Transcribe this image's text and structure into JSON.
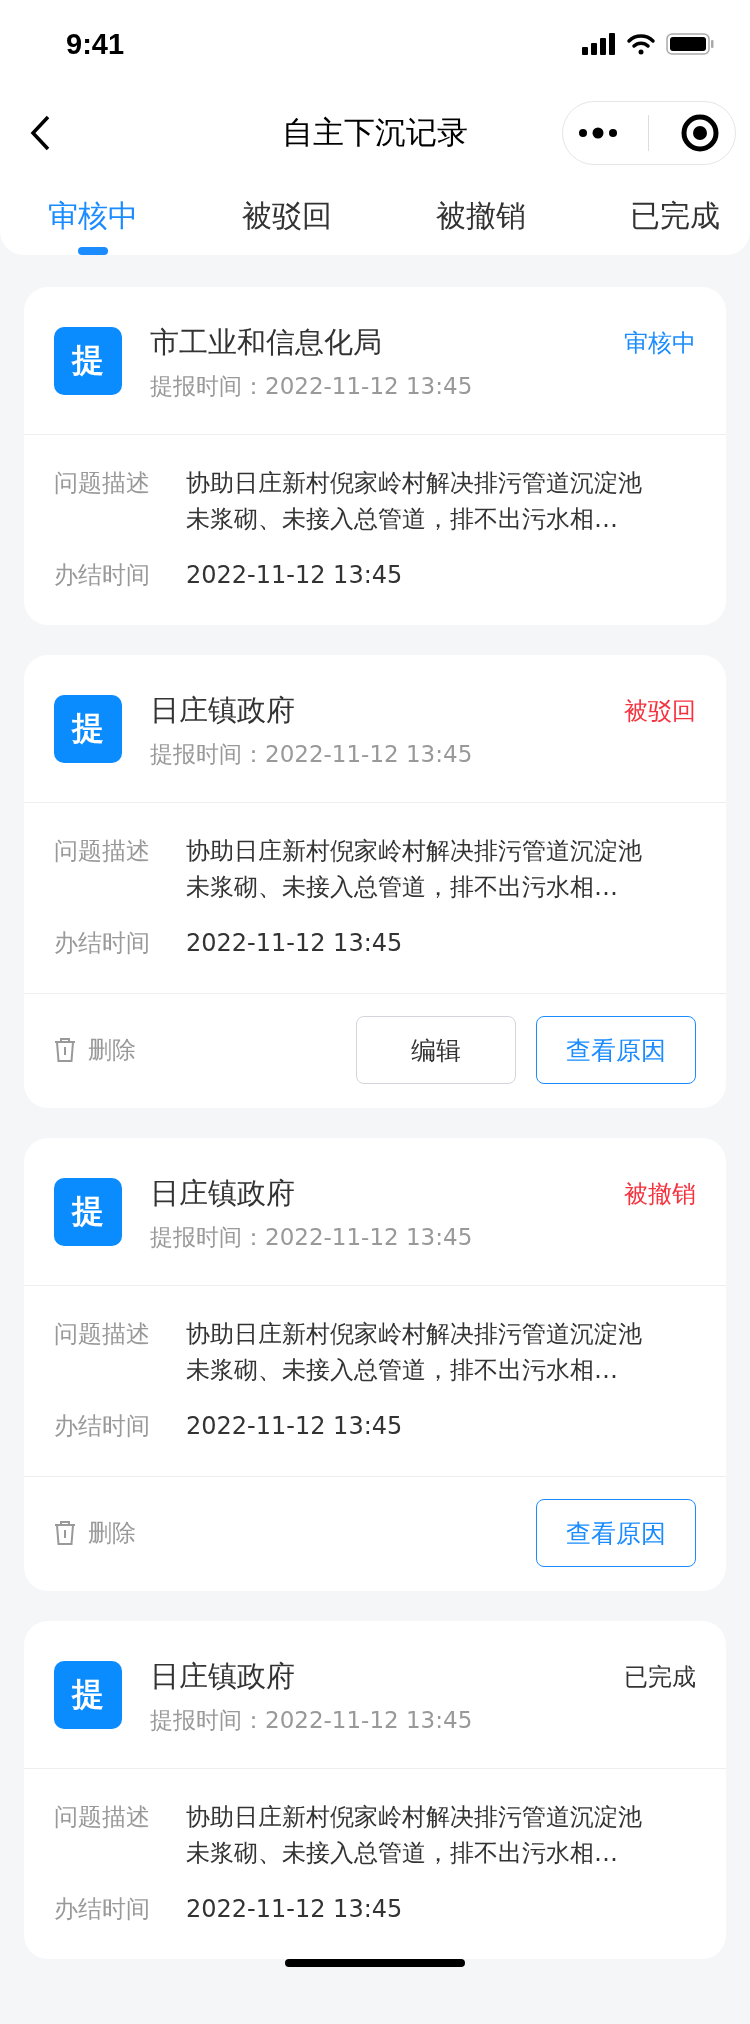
{
  "status_bar": {
    "time": "9:41"
  },
  "nav": {
    "title": "自主下沉记录"
  },
  "tabs": [
    {
      "label": "审核中",
      "selected": true
    },
    {
      "label": "被驳回",
      "selected": false
    },
    {
      "label": "被撤销",
      "selected": false
    },
    {
      "label": "已完成",
      "selected": false
    }
  ],
  "records": [
    {
      "badge": "提",
      "org": "市工业和信息化局",
      "time_label": "提报时间：",
      "time": "2022-11-12 13:45",
      "status": {
        "text": "审核中",
        "color": "#1a8cff"
      },
      "fields": [
        {
          "label": "问题描述",
          "value": "协助日庄新村倪家岭村解决排污管道沉淀池未浆砌、未接入总管道，排不出污水相…"
        },
        {
          "label": "办结时间",
          "value": "2022-11-12 13:45"
        }
      ]
    },
    {
      "badge": "提",
      "org": "日庄镇政府",
      "time_label": "提报时间：",
      "time": "2022-11-12 13:45",
      "status": {
        "text": "被驳回",
        "color": "#f5333f"
      },
      "fields": [
        {
          "label": "问题描述",
          "value": "协助日庄新村倪家岭村解决排污管道沉淀池未浆砌、未接入总管道，排不出污水相…"
        },
        {
          "label": "办结时间",
          "value": "2022-11-12 13:45"
        }
      ],
      "footer": {
        "delete": "删除",
        "buttons": [
          {
            "kind": "secondary",
            "label": "编辑"
          },
          {
            "kind": "primary",
            "label": "查看原因"
          }
        ]
      }
    },
    {
      "badge": "提",
      "org": "日庄镇政府",
      "time_label": "提报时间：",
      "time": "2022-11-12 13:45",
      "status": {
        "text": "被撤销",
        "color": "#f5333f"
      },
      "fields": [
        {
          "label": "问题描述",
          "value": "协助日庄新村倪家岭村解决排污管道沉淀池未浆砌、未接入总管道，排不出污水相…"
        },
        {
          "label": "办结时间",
          "value": "2022-11-12 13:45"
        }
      ],
      "footer": {
        "delete": "删除",
        "buttons": [
          {
            "kind": "primary",
            "label": "查看原因"
          }
        ]
      }
    },
    {
      "badge": "提",
      "org": "日庄镇政府",
      "time_label": "提报时间：",
      "time": "2022-11-12 13:45",
      "status": {
        "text": "已完成",
        "color": "#333333"
      },
      "fields": [
        {
          "label": "问题描述",
          "value": "协助日庄新村倪家岭村解决排污管道沉淀池未浆砌、未接入总管道，排不出污水相…"
        },
        {
          "label": "办结时间",
          "value": "2022-11-12 13:45"
        }
      ]
    }
  ]
}
